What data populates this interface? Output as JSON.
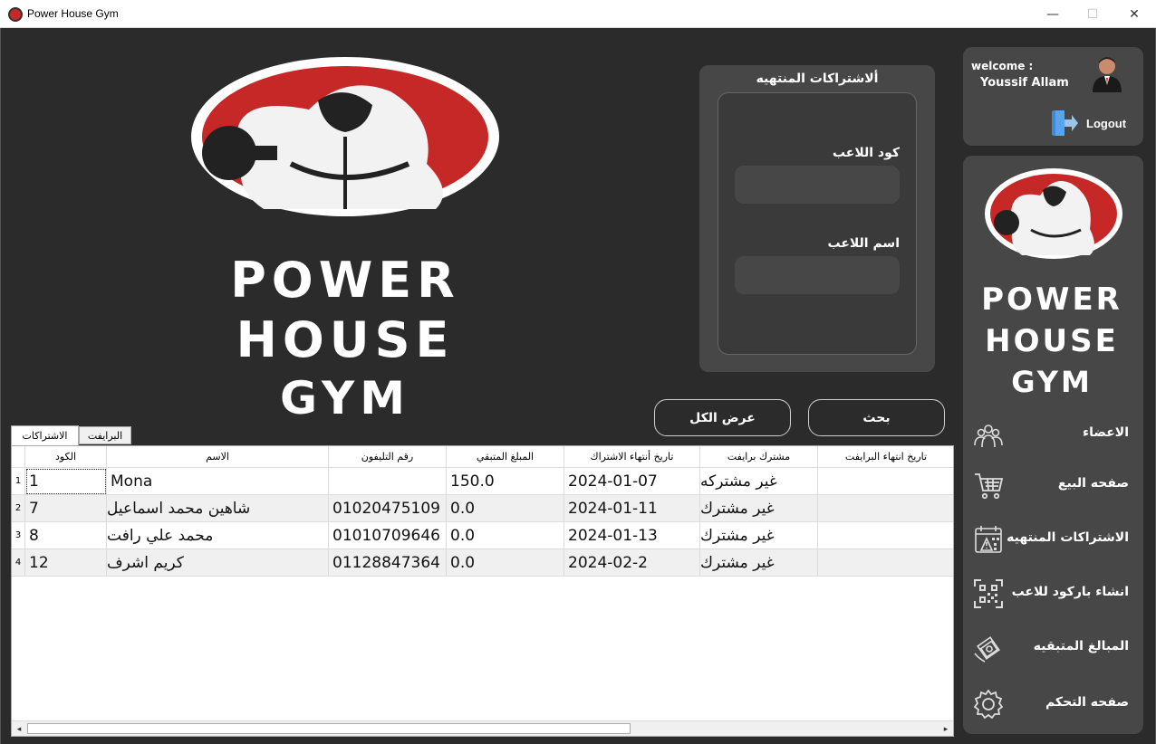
{
  "window": {
    "title": "Power House Gym",
    "minimize": "—",
    "maximize": "☐",
    "close": "✕"
  },
  "logo": {
    "line1": "POWER",
    "line2": "HOUSE",
    "line3": "GYM",
    "brand_red": "#c62828"
  },
  "expired_panel": {
    "title": "ألاشتراكات المنتهيه",
    "code_label": "كود اللاعب",
    "code_value": "",
    "name_label": "اسم اللاعب",
    "name_value": ""
  },
  "buttons": {
    "search": "بحث",
    "show_all": "عرض الكل"
  },
  "tabs": [
    {
      "label": "الاشتراكات",
      "active": true
    },
    {
      "label": "البرايفت",
      "active": false
    }
  ],
  "table": {
    "headers": [
      "الكود",
      "الاسم",
      "رقم التليفون",
      "المبلغ المتبقي",
      "تاريخ أنتهاء الاشتراك",
      "مشترك برايفت",
      "تاريخ انتهاء البرايفت"
    ],
    "rows": [
      {
        "num": "1",
        "code": "1",
        "name": "Mona",
        "phone": "",
        "remaining": "150.0",
        "end_date": "2024-01-07",
        "private": "غير مشتركه",
        "private_end": ""
      },
      {
        "num": "2",
        "code": "7",
        "name": "شاهين محمد اسماعيل",
        "phone": "01020475109",
        "remaining": "0.0",
        "end_date": "2024-01-11",
        "private": "غير مشترك",
        "private_end": ""
      },
      {
        "num": "3",
        "code": "8",
        "name": "محمد علي رافت",
        "phone": "01010709646",
        "remaining": "0.0",
        "end_date": "2024-01-13",
        "private": "غير مشترك",
        "private_end": ""
      },
      {
        "num": "4",
        "code": "12",
        "name": "كريم اشرف",
        "phone": "01128847364",
        "remaining": "0.0",
        "end_date": "2024-02-2",
        "private": "غير مشترك",
        "private_end": ""
      }
    ],
    "scroll_left": "◂",
    "scroll_right": "▸"
  },
  "user": {
    "welcome": "welcome :",
    "name": "Youssif Allam",
    "logout": "Logout"
  },
  "nav": [
    {
      "label": "الاعضاء",
      "icon": "members-icon"
    },
    {
      "label": "صفحه البيع",
      "icon": "cart-icon"
    },
    {
      "label": "الاشتراكات المنتهيه",
      "icon": "calendar-warning-icon"
    },
    {
      "label": "انشاء باركود للاعب",
      "icon": "qr-code-icon"
    },
    {
      "label": "المبالغ المتبقيه",
      "icon": "money-icon"
    },
    {
      "label": "صفحه التحكم",
      "icon": "gear-icon"
    }
  ]
}
